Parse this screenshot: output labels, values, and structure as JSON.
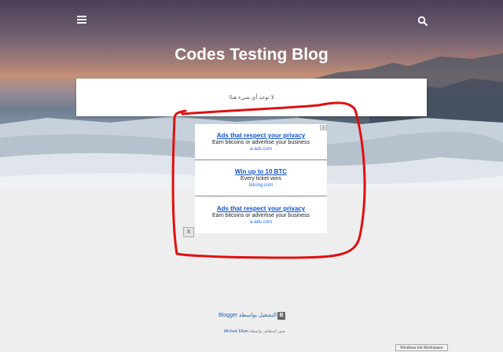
{
  "header": {
    "menu_icon": "hamburger-menu-icon",
    "search_icon": "search-icon",
    "title": "Codes Testing Blog"
  },
  "post": {
    "empty_message": "لا توجد أي شيء هنا!"
  },
  "ads": [
    {
      "headline": "Ads that respect your privacy",
      "text": "Earn bitcoins or advertise your business",
      "url": "a-ads.com"
    },
    {
      "headline": "Win up to 10 BTC",
      "text": "Every ticket wins",
      "url": "bitiong.com"
    },
    {
      "headline": "Ads that respect your privacy",
      "text": "Earn bitcoins or advertise your business",
      "url": "a-ads.com"
    }
  ],
  "close_button": {
    "label": "X"
  },
  "footer": {
    "powered_by": "Blogger يتم التشغيل بواسطة",
    "theme_prefix": "صور المظاهر بواسطة",
    "theme_author": "Michael Elkan"
  },
  "taskbar_tooltip": "Windows Ink Workspace",
  "colors": {
    "annotation": "#e01010",
    "link": "#1155cc"
  }
}
